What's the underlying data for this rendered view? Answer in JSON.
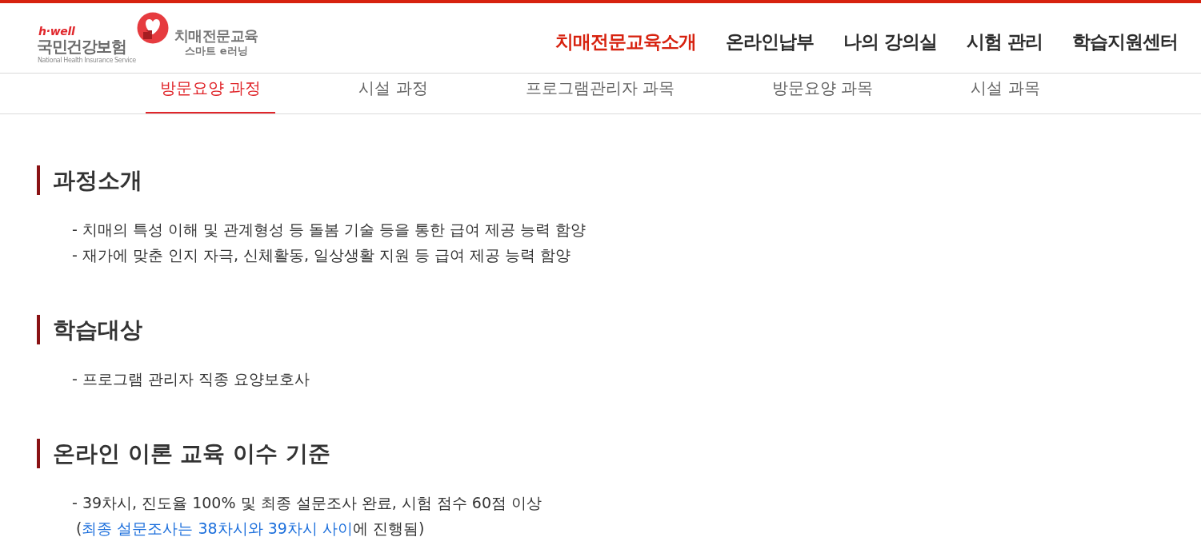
{
  "header": {
    "logo": {
      "tagline": "h·well",
      "name": "국민건강보험",
      "name_en": "National Health Insurance Service",
      "service_title": "치매전문교육",
      "service_subtitle": "스마트 e러닝"
    },
    "nav": [
      {
        "label": "치매전문교육소개",
        "selected": true
      },
      {
        "label": "온라인납부",
        "selected": false
      },
      {
        "label": "나의 강의실",
        "selected": false
      },
      {
        "label": "시험 관리",
        "selected": false
      },
      {
        "label": "학습지원센터",
        "selected": false
      }
    ]
  },
  "subtabs": [
    {
      "label": "방문요양 과정",
      "selected": true
    },
    {
      "label": "시설 과정",
      "selected": false
    },
    {
      "label": "프로그램관리자 과목",
      "selected": false
    },
    {
      "label": "방문요양 과목",
      "selected": false
    },
    {
      "label": "시설 과목",
      "selected": false
    }
  ],
  "sections": [
    {
      "title": "과정소개",
      "items": [
        {
          "kind": "bullet",
          "text": "- 치매의 특성 이해 및 관계형성 등 돌봄 기술 등을 통한 급여 제공 능력 함양"
        },
        {
          "kind": "bullet",
          "text": "- 재가에 맞춘 인지 자극, 신체활동, 일상생활 지원 등 급여 제공 능력 함양"
        }
      ]
    },
    {
      "title": "학습대상",
      "items": [
        {
          "kind": "bullet",
          "text": "- 프로그램 관리자 직종 요양보호사"
        }
      ]
    },
    {
      "title": "온라인 이론 교육 이수 기준",
      "items": [
        {
          "kind": "bullet",
          "text": "- 39차시, 진도율 100% 및 최종 설문조사 완료, 시험 점수 60점 이상"
        },
        {
          "kind": "note",
          "segments": [
            {
              "text": "(",
              "highlight": false
            },
            {
              "text": "최종 설문조사는 38차시와 39차시 사이",
              "highlight": true
            },
            {
              "text": "에 진행됨)",
              "highlight": false
            }
          ]
        }
      ]
    }
  ]
}
